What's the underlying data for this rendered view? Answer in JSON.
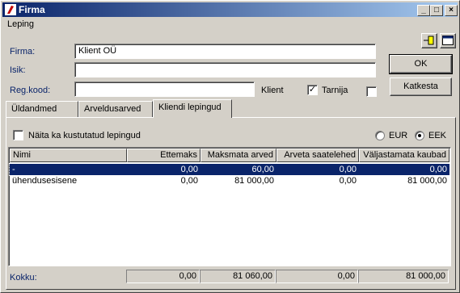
{
  "window": {
    "title": "Firma"
  },
  "menu": {
    "item": "Leping"
  },
  "form": {
    "firma_label": "Firma:",
    "firma_value": "Klient OÜ",
    "isik_label": "Isik:",
    "isik_value": "",
    "regkood_label": "Reg.kood:",
    "regkood_value": "",
    "klient_label": "Klient",
    "tarnija_label": "Tarnija",
    "klient_checked": true,
    "tarnija_checked": false
  },
  "buttons": {
    "ok": "OK",
    "cancel": "Katkesta"
  },
  "tabs": [
    {
      "label": "Üldandmed",
      "active": false
    },
    {
      "label": "Arveldusarved",
      "active": false
    },
    {
      "label": "Kliendi lepingud",
      "active": true
    }
  ],
  "contracts": {
    "show_deleted_label": "Näita ka kustutatud lepingud",
    "show_deleted_checked": false,
    "currency_eur": "EUR",
    "currency_eek": "EEK",
    "currency_selected": "EEK"
  },
  "table": {
    "columns": [
      "Nimi",
      "Ettemaks",
      "Maksmata arved",
      "Arveta saatelehed",
      "Väljastamata kaubad"
    ],
    "rows": [
      [
        "-",
        "0,00",
        "60,00",
        "0,00",
        "0,00"
      ],
      [
        "ühendusesisene",
        "0,00",
        "81 000,00",
        "0,00",
        "81 000,00"
      ]
    ],
    "selected_row": 0
  },
  "totals": {
    "label": "Kokku:",
    "values": [
      "0,00",
      "81 060,00",
      "0,00",
      "81 000,00"
    ]
  }
}
